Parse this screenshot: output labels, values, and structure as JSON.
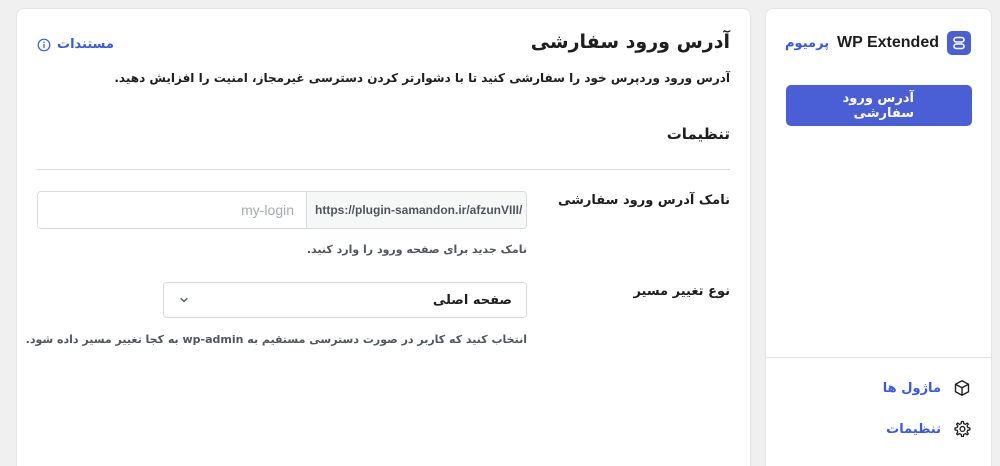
{
  "sidebar": {
    "brand_name": "WP Extended",
    "brand_badge": "پرمیوم",
    "active_item": "آدرس ورود سفارشی",
    "footer_links": [
      {
        "label": "ماژول ها",
        "icon": "cube-icon"
      },
      {
        "label": "تنظیمات",
        "icon": "gear-icon"
      }
    ]
  },
  "main": {
    "title": "آدرس ورود سفارشی",
    "docs_link": "مستندات",
    "description": "آدرس ورود وردپرس خود را سفارشی کنید تا با دشوارتر کردن دسترسی غیرمجاز، امنیت را افزایش دهید.",
    "section_title": "تنظیمات",
    "fields": {
      "login_slug": {
        "label": "نامک آدرس ورود سفارشی",
        "prefix": "https://plugin-samandon.ir/afzunVIII/",
        "value": "",
        "placeholder": "my-login",
        "help": "نامک جدید برای صفحه ورود را وارد کنید."
      },
      "redirect_type": {
        "label": "نوع تغییر مسیر",
        "selected": "صفحه اصلی",
        "help": "انتخاب کنید که کاربر در صورت دسترسی مستقیم به wp-admin به کجا تغییر مسیر داده شود."
      }
    }
  },
  "colors": {
    "accent": "#4a5fd6",
    "link": "#3858e9",
    "background": "#f0f0f1"
  }
}
